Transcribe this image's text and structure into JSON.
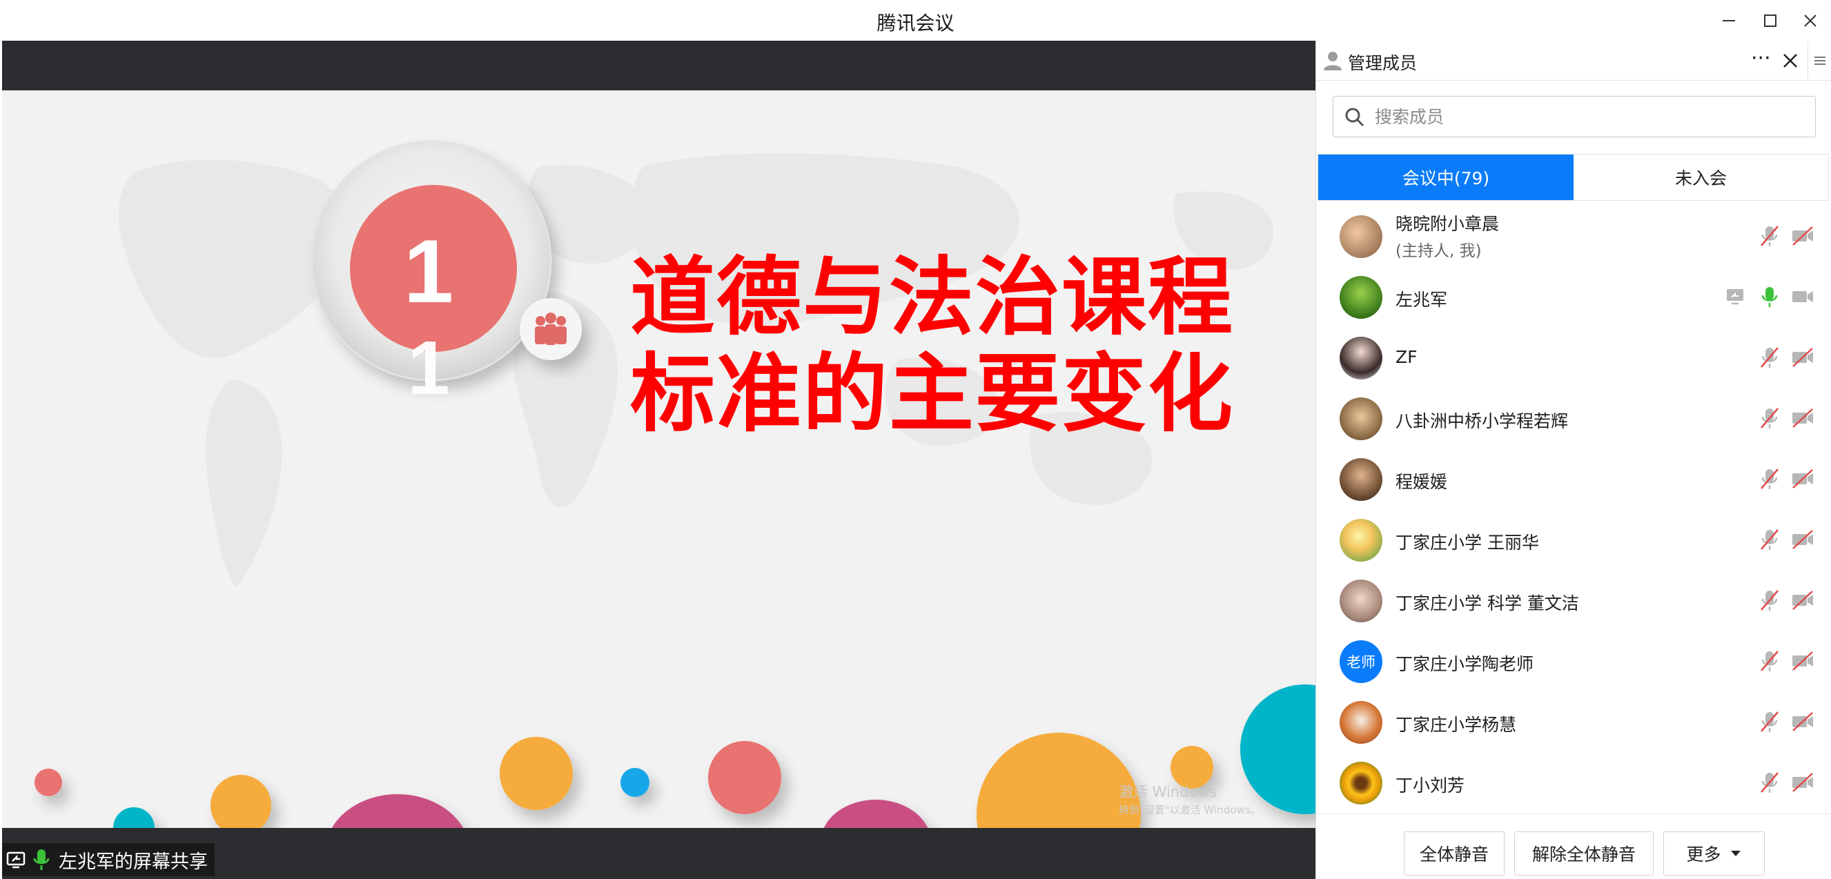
{
  "window": {
    "title": "腾讯会议",
    "controls": [
      "minimize-icon",
      "maximize-icon",
      "close-icon"
    ]
  },
  "share": {
    "label": "左兆军的屏幕共享",
    "slide": {
      "number": "1",
      "number_shadow": "1",
      "headline_line1": "道德与法治课程",
      "headline_line2": "标准的主要变化",
      "headline_color": "#ff0000",
      "badge_color": "#e87370"
    },
    "watermark": {
      "line1": "激活 Windows",
      "line2": "转到\"设置\"以激活 Windows。"
    }
  },
  "panel": {
    "title": "管理成员",
    "more_label": "···",
    "search": {
      "placeholder": "搜索成员"
    },
    "tabs": [
      {
        "label": "会议中(79)",
        "active": true
      },
      {
        "label": "未入会",
        "active": false
      }
    ],
    "members": [
      {
        "name": "晓晥附小章晨",
        "subtitle": "(主持人, 我)",
        "avatar": "photo-child",
        "mic": "muted",
        "video": "off",
        "sharing": false
      },
      {
        "name": "左兆军",
        "subtitle": "",
        "avatar": "photo-tree",
        "mic": "on",
        "video": "on",
        "sharing": true
      },
      {
        "name": "ZF",
        "subtitle": "",
        "avatar": "photo-woman",
        "mic": "muted",
        "video": "off",
        "sharing": false
      },
      {
        "name": "八卦洲中桥小学程若辉",
        "subtitle": "",
        "avatar": "photo-cat",
        "mic": "muted",
        "video": "off",
        "sharing": false
      },
      {
        "name": "程媛媛",
        "subtitle": "",
        "avatar": "photo-man",
        "mic": "muted",
        "video": "off",
        "sharing": false
      },
      {
        "name": "丁家庄小学  王丽华",
        "subtitle": "",
        "avatar": "photo-sunset",
        "mic": "muted",
        "video": "off",
        "sharing": false
      },
      {
        "name": "丁家庄小学 科学 董文洁",
        "subtitle": "",
        "avatar": "photo-cartoon",
        "mic": "muted",
        "video": "off",
        "sharing": false
      },
      {
        "name": "丁家庄小学陶老师",
        "subtitle": "",
        "avatar": "text",
        "avatar_text": "老师",
        "mic": "muted",
        "video": "off",
        "sharing": false
      },
      {
        "name": "丁家庄小学杨慧",
        "subtitle": "",
        "avatar": "photo-tiger",
        "mic": "muted",
        "video": "off",
        "sharing": false
      },
      {
        "name": "丁小刘芳",
        "subtitle": "",
        "avatar": "photo-sunflower",
        "mic": "muted",
        "video": "off",
        "sharing": false
      }
    ],
    "footer": {
      "mute_all": "全体静音",
      "unmute_all": "解除全体静音",
      "more": "更多"
    }
  },
  "colors": {
    "accent": "#0a7cfa",
    "mic_on": "#3cc13b",
    "muted_slash": "#e24b4b",
    "icon_gray": "#b7b7b7",
    "dark_band": "#2b2d30"
  }
}
